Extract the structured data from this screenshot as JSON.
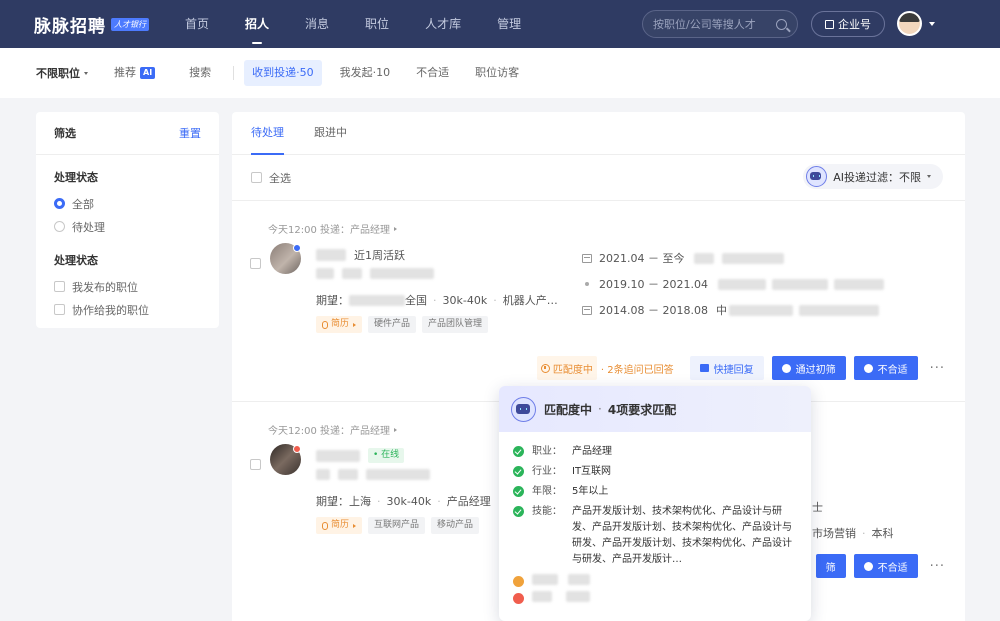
{
  "topbar": {
    "logo_text": "脉脉招聘",
    "logo_badge": "人才银行",
    "nav": [
      {
        "label": "首页",
        "active": false
      },
      {
        "label": "招人",
        "active": true
      },
      {
        "label": "消息",
        "active": false
      },
      {
        "label": "职位",
        "active": false
      },
      {
        "label": "人才库",
        "active": false
      },
      {
        "label": "管理",
        "active": false
      }
    ],
    "search_placeholder": "按职位/公司等搜人才",
    "enterprise_label": "企业号"
  },
  "subbar": {
    "job_filter": "不限职位",
    "tabs": [
      {
        "label": "推荐",
        "badge": "AI",
        "active": false
      },
      {
        "label": "搜索",
        "active": false
      },
      {
        "label": "收到投递·50",
        "active": true
      },
      {
        "label": "我发起·10",
        "active": false
      },
      {
        "label": "不合适",
        "active": false
      },
      {
        "label": "职位访客",
        "active": false
      }
    ]
  },
  "filter": {
    "title": "筛选",
    "reset": "重置",
    "group1": {
      "title": "处理状态",
      "options": [
        "全部",
        "待处理"
      ],
      "selected": "全部"
    },
    "group2": {
      "title": "处理状态",
      "options": [
        "我发布的职位",
        "协作给我的职位"
      ]
    }
  },
  "main": {
    "tabs": [
      "待处理",
      "跟进中"
    ],
    "select_all": "全选",
    "ai_filter_label": "AI投递过滤：不限"
  },
  "cards": [
    {
      "meta_time": "今天12:00",
      "meta_job": "投递：产品经理",
      "active_status": "近1周活跃",
      "expect_label": "期望：",
      "expect_city_suffix": "全国",
      "expect_salary": "30k-40k",
      "expect_industry": "机器人产…",
      "tags": [
        "简历",
        "硬件产品",
        "产品团队管理"
      ],
      "history": [
        {
          "period": "2021.04 － 至今",
          "icon": "calendar"
        },
        {
          "period": "2019.10 － 2021.04",
          "icon": "dot"
        },
        {
          "period": "2014.08 － 2018.08",
          "icon": "calendar",
          "org_prefix": "中"
        }
      ],
      "match_label": "匹配度中",
      "match_extra": "· 2条追问已回答",
      "btn_reply": "快捷回复",
      "btn_pass": "通过初筛",
      "btn_reject": "不合适"
    },
    {
      "meta_time": "今天12:00",
      "meta_job": "投递：产品经理",
      "online": "• 在线",
      "expect_label": "期望：",
      "expect_city": "上海",
      "expect_salary": "30k-40k",
      "expect_job": "产品经理",
      "tags": [
        "简历",
        "互联网产品",
        "移动产品"
      ],
      "right_line1": "士",
      "right_line2_a": "市场营销",
      "right_line2_b": "本科",
      "btn_pass_tail": "筛",
      "btn_reject": "不合适"
    }
  ],
  "popover": {
    "title_a": "匹配度中",
    "title_b": "4项要求匹配",
    "rows": [
      {
        "key": "职业：",
        "val": "产品经理",
        "status": "ok"
      },
      {
        "key": "行业：",
        "val": "IT互联网",
        "status": "ok"
      },
      {
        "key": "年限：",
        "val": "5年以上",
        "status": "ok"
      },
      {
        "key": "技能：",
        "val": "产品开发版计划、技术架构优化、产品设计与研发、产品开发版计划、技术架构优化、产品设计与研发、产品开发版计划、技术架构优化、产品设计与研发、产品开发版计…",
        "status": "ok"
      }
    ]
  },
  "colors": {
    "primary": "#3b6bf6",
    "nav_bg": "#2f3b63",
    "warn": "#e88d32",
    "ok": "#2bb45a",
    "danger": "#f05d4d"
  }
}
